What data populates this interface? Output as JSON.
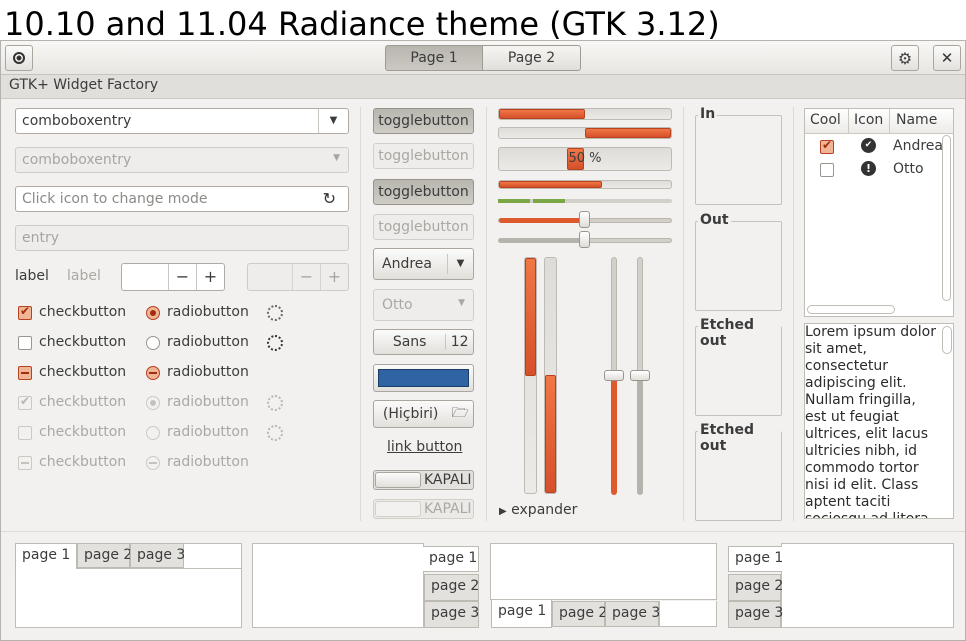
{
  "heading": "10.10 and 11.04 Radiance theme (GTK 3.12)",
  "headerbar": {
    "switcher": [
      "Page 1",
      "Page 2"
    ],
    "window_title": "GTK+ Widget Factory"
  },
  "left": {
    "combo1": "comboboxentry",
    "combo2": "comboboxentry",
    "mode_entry_placeholder": "Click icon to change mode",
    "entry_placeholder": "entry",
    "label1": "label",
    "label2": "label",
    "spin_minus": "−",
    "spin_plus": "+",
    "check_label": "checkbutton",
    "radio_label": "radiobutton"
  },
  "buttons": {
    "toggle": "togglebutton",
    "combo_andrea": "Andrea",
    "combo_otto": "Otto",
    "font_name": "Sans",
    "font_size": "12",
    "color": "#2f64a4",
    "file_chooser": "(Hiçbiri)",
    "link": "link button",
    "switch_off": "KAPALI"
  },
  "progress": {
    "bar1": 0.5,
    "bar2": 0.5,
    "bar3_text": "50 %",
    "bar3": 0.5,
    "bar4": 0.6,
    "expander": "expander"
  },
  "frames": [
    "In",
    "Out",
    "Etched out",
    "Etched out"
  ],
  "tree": {
    "columns": [
      "Cool",
      "Icon",
      "Name"
    ],
    "rows": [
      {
        "cool": true,
        "icon": "check-circle-icon",
        "name": "Andrea"
      },
      {
        "cool": false,
        "icon": "warning-circle-icon",
        "name": "Otto"
      }
    ]
  },
  "textview": "Lorem ipsum dolor sit amet, consectetur adipiscing elit. Nullam fringilla, est ut feugiat ultrices, elit lacus ultricies nibh, id commodo tortor nisi id elit. Class aptent taciti sociosqu ad litora",
  "notebook_tabs": [
    "page 1",
    "page 2",
    "page 3"
  ],
  "colors": {
    "accent": "#e0622e",
    "window_bg": "#f2f1f0"
  }
}
